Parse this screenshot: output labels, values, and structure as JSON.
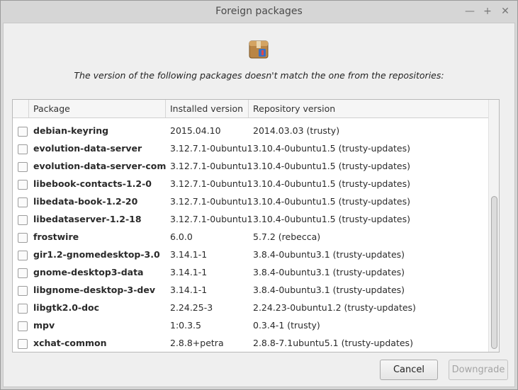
{
  "window": {
    "title": "Foreign packages",
    "controls": {
      "minimize": "—",
      "maximize": "+",
      "close": "✕"
    }
  },
  "message": "The version of the following packages doesn't match the one from the repositories:",
  "icon": "package-box-icon",
  "table": {
    "columns": [
      "Package",
      "Installed version",
      "Repository version"
    ],
    "rows": [
      {
        "package": "debian-keyring",
        "installed": "2015.04.10",
        "repo": "2014.03.03 (trusty)"
      },
      {
        "package": "evolution-data-server",
        "installed": "3.12.7.1-0ubuntu1",
        "repo": "3.10.4-0ubuntu1.5 (trusty-updates)"
      },
      {
        "package": "evolution-data-server-common",
        "installed": "3.12.7.1-0ubuntu1",
        "repo": "3.10.4-0ubuntu1.5 (trusty-updates)"
      },
      {
        "package": "libebook-contacts-1.2-0",
        "installed": "3.12.7.1-0ubuntu1",
        "repo": "3.10.4-0ubuntu1.5 (trusty-updates)"
      },
      {
        "package": "libedata-book-1.2-20",
        "installed": "3.12.7.1-0ubuntu1",
        "repo": "3.10.4-0ubuntu1.5 (trusty-updates)"
      },
      {
        "package": "libedataserver-1.2-18",
        "installed": "3.12.7.1-0ubuntu1",
        "repo": "3.10.4-0ubuntu1.5 (trusty-updates)"
      },
      {
        "package": "frostwire",
        "installed": "6.0.0",
        "repo": "5.7.2 (rebecca)"
      },
      {
        "package": "gir1.2-gnomedesktop-3.0",
        "installed": "3.14.1-1",
        "repo": "3.8.4-0ubuntu3.1 (trusty-updates)"
      },
      {
        "package": "gnome-desktop3-data",
        "installed": "3.14.1-1",
        "repo": "3.8.4-0ubuntu3.1 (trusty-updates)"
      },
      {
        "package": "libgnome-desktop-3-dev",
        "installed": "3.14.1-1",
        "repo": "3.8.4-0ubuntu3.1 (trusty-updates)"
      },
      {
        "package": "libgtk2.0-doc",
        "installed": "2.24.25-3",
        "repo": "2.24.23-0ubuntu1.2 (trusty-updates)"
      },
      {
        "package": "mpv",
        "installed": "1:0.3.5",
        "repo": "0.3.4-1 (trusty)"
      },
      {
        "package": "xchat-common",
        "installed": "2.8.8+petra",
        "repo": "2.8.8-7.1ubuntu5.1 (trusty-updates)"
      }
    ]
  },
  "buttons": {
    "cancel": "Cancel",
    "downgrade": "Downgrade",
    "downgrade_enabled": false
  }
}
